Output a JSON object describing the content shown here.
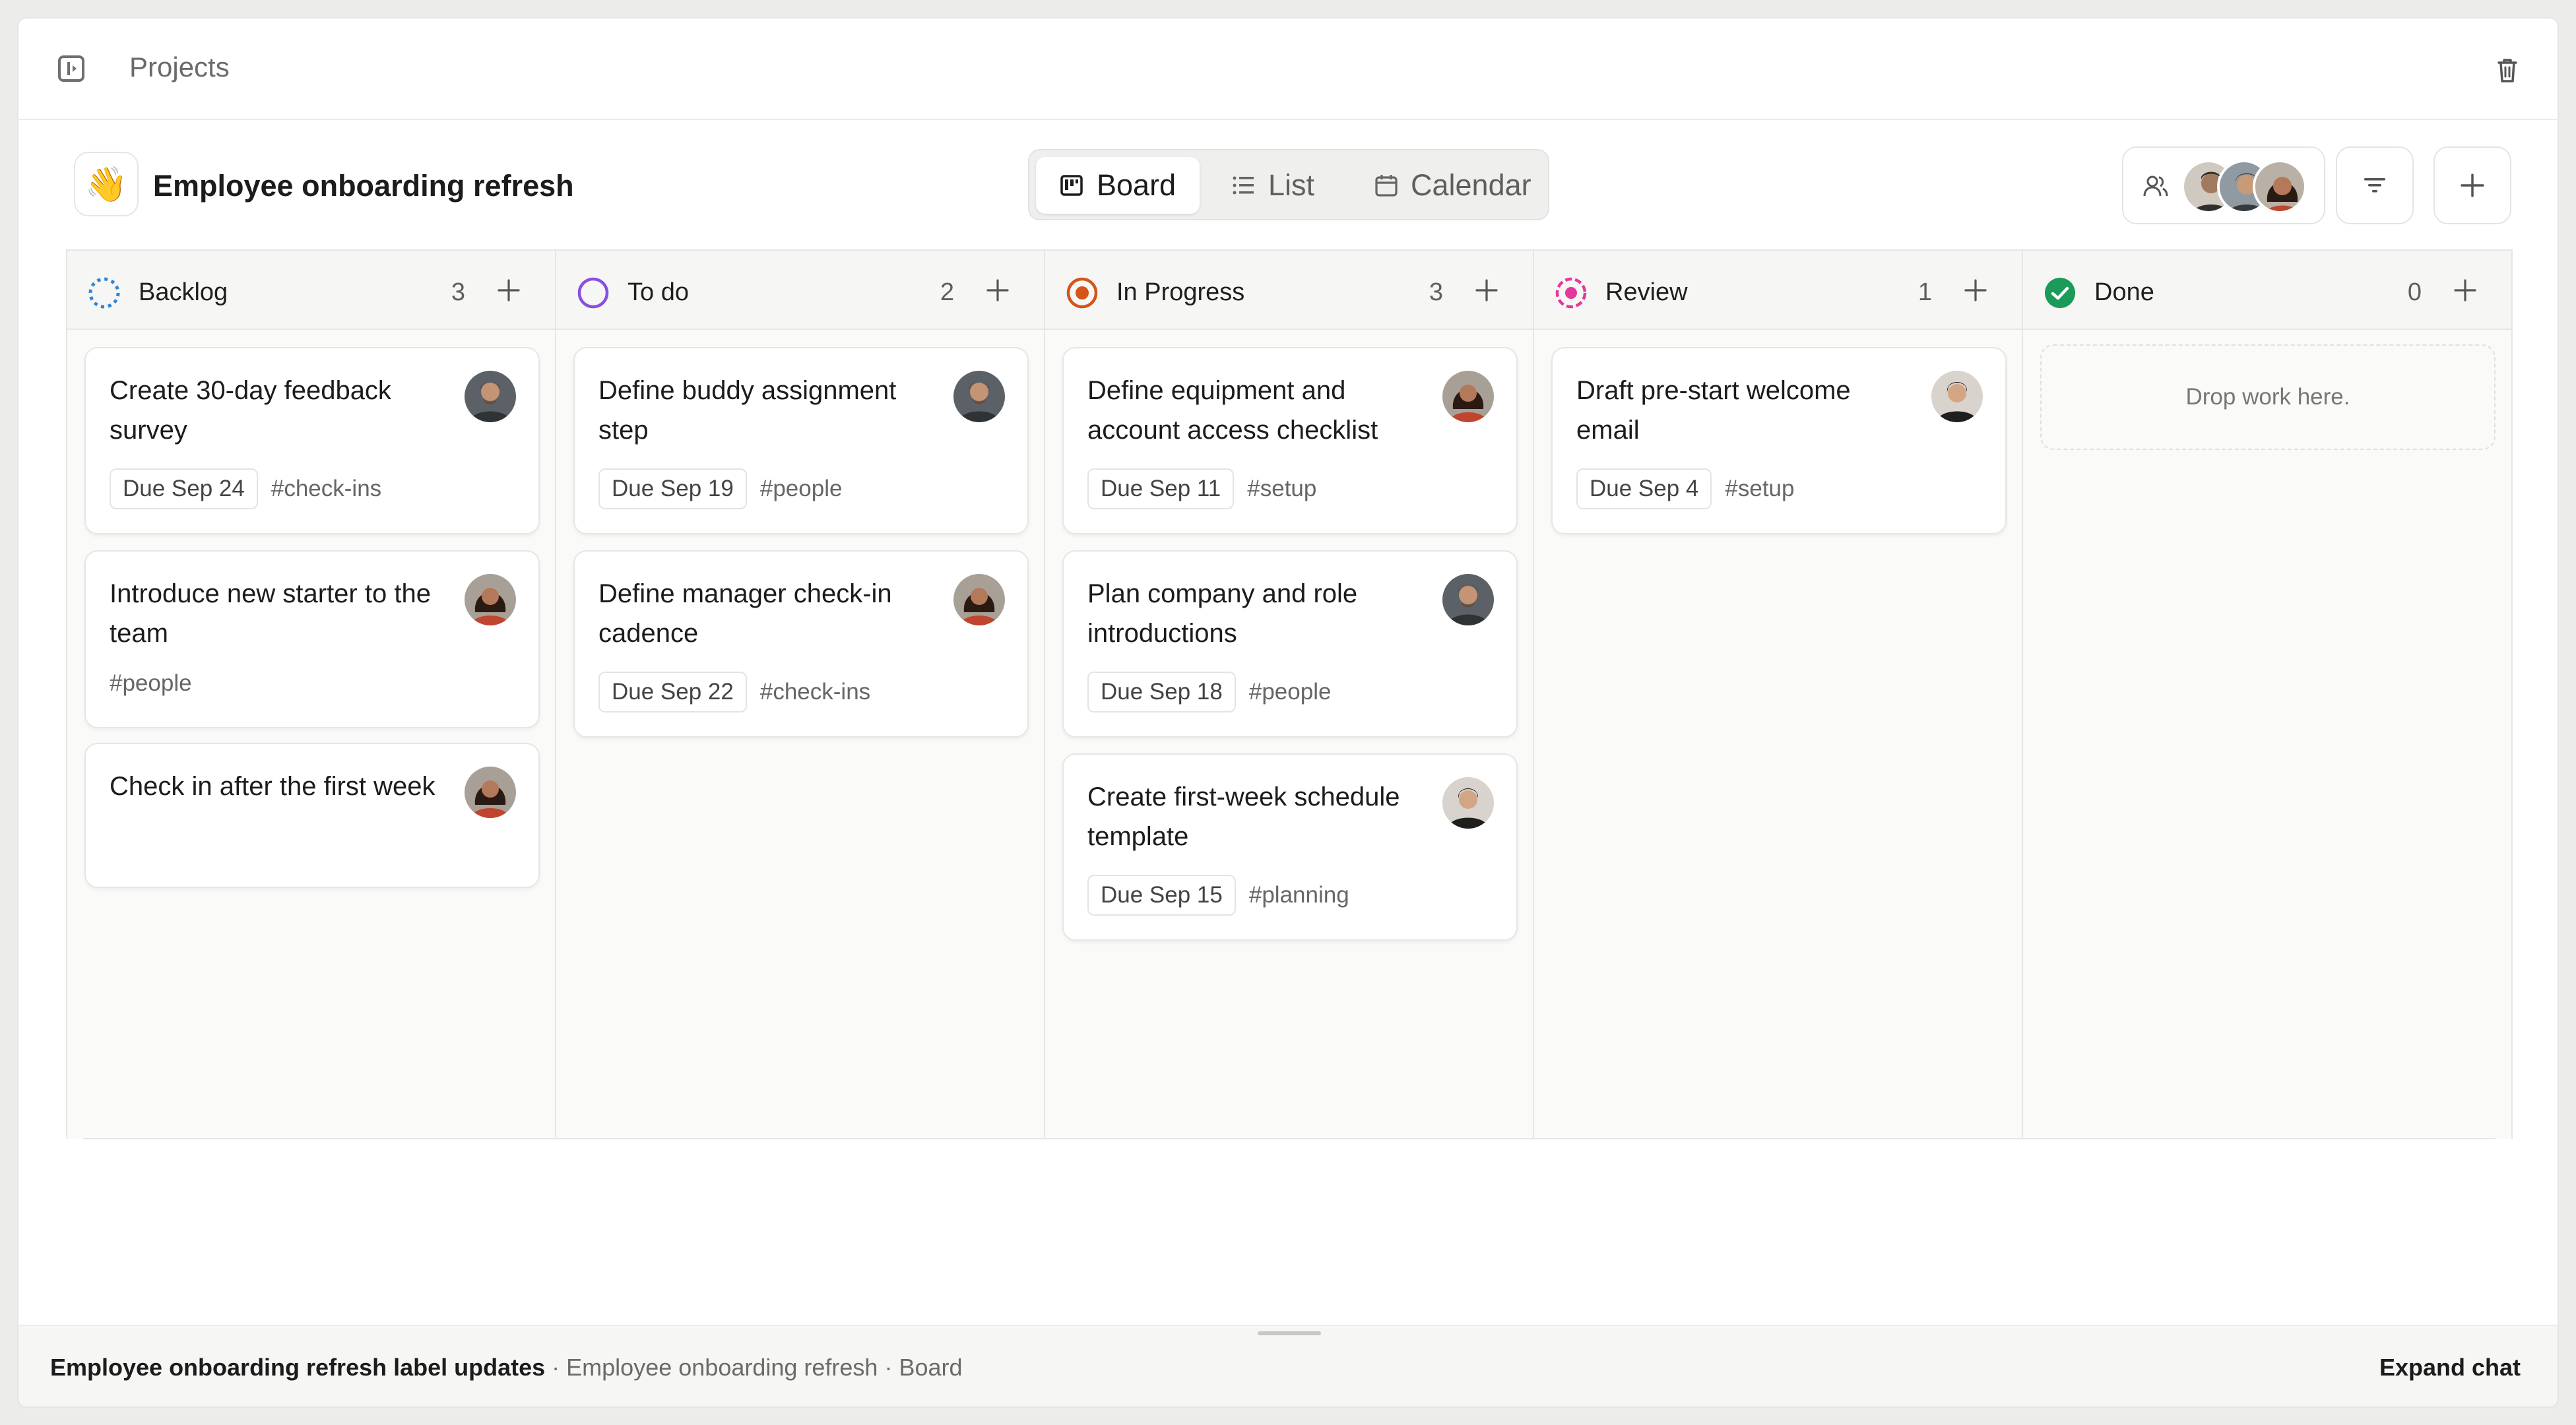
{
  "topbar": {
    "breadcrumb": "Projects"
  },
  "project": {
    "emoji": "👋",
    "title": "Employee onboarding refresh"
  },
  "views": {
    "board_label": "Board",
    "list_label": "List",
    "calendar_label": "Calendar",
    "active": "Board"
  },
  "columns": [
    {
      "title": "Backlog",
      "count": "3",
      "status_color": "#2f86d6",
      "cards": [
        {
          "title": "Create 30-day feedback survey",
          "due": "Due Sep 24",
          "tag": "#check-ins"
        },
        {
          "title": "Introduce new starter to the team",
          "tag": "#people"
        },
        {
          "title": "Check in after the first week"
        }
      ]
    },
    {
      "title": "To do",
      "count": "2",
      "status_color": "#8a4fe0",
      "cards": [
        {
          "title": "Define buddy assignment step",
          "due": "Due Sep 19",
          "tag": "#people"
        },
        {
          "title": "Define manager check-in cadence",
          "due": "Due Sep 22",
          "tag": "#check-ins"
        }
      ]
    },
    {
      "title": "In Progress",
      "count": "3",
      "status_color": "#d4541a",
      "cards": [
        {
          "title": "Define equipment and account access checklist",
          "due": "Due Sep 11",
          "tag": "#setup"
        },
        {
          "title": "Plan company and role introductions",
          "due": "Due Sep 18",
          "tag": "#people"
        },
        {
          "title": "Create first-week schedule template",
          "due": "Due Sep 15",
          "tag": "#planning"
        }
      ]
    },
    {
      "title": "Review",
      "count": "1",
      "status_color": "#e2399a",
      "cards": [
        {
          "title": "Draft pre-start welcome email",
          "due": "Due Sep 4",
          "tag": "#setup"
        }
      ]
    },
    {
      "title": "Done",
      "count": "0",
      "status_color": "#1c9a5a",
      "empty_text": "Drop work here."
    }
  ],
  "footer": {
    "chat_title": "Employee onboarding refresh label updates",
    "chat_context": " · Employee onboarding refresh · Board",
    "expand_label": "Expand chat"
  }
}
